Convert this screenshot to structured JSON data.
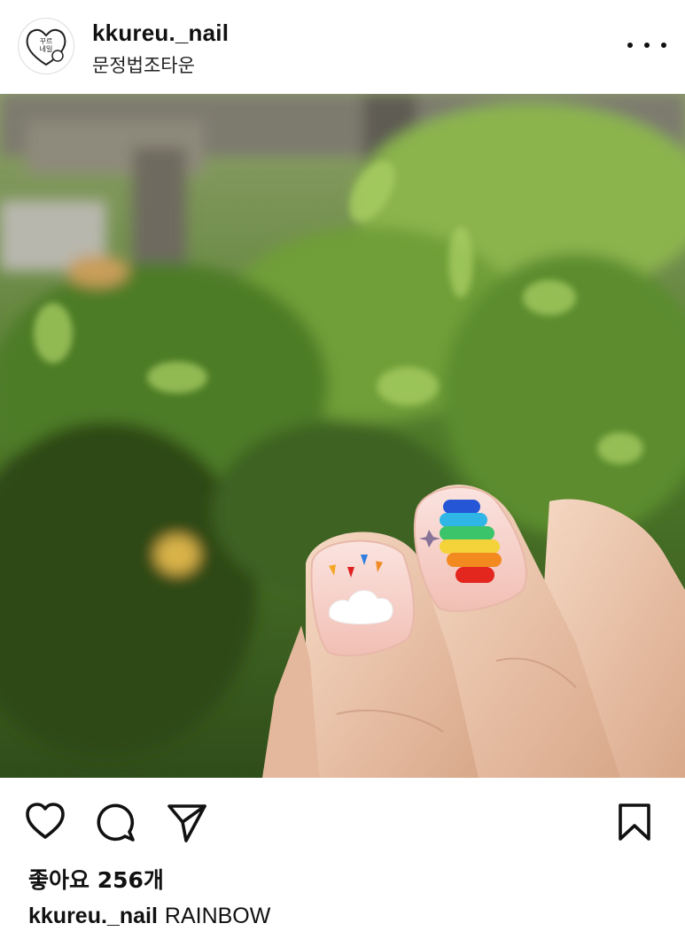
{
  "post": {
    "username": "kkureu._nail",
    "location": "문정법조타운",
    "avatar_text_line1": "꾸르",
    "avatar_text_line2": "네일",
    "likes": "좋아요 256개",
    "caption_user": "kkureu._nail",
    "caption_text": "RAINBOW"
  },
  "icons": {
    "more": "more-options-icon",
    "like": "heart-icon",
    "comment": "comment-icon",
    "share": "share-paper-plane-icon",
    "save": "bookmark-icon"
  },
  "colors": {
    "text": "#111111",
    "background": "#ffffff",
    "divider": "#dbdbdb"
  }
}
